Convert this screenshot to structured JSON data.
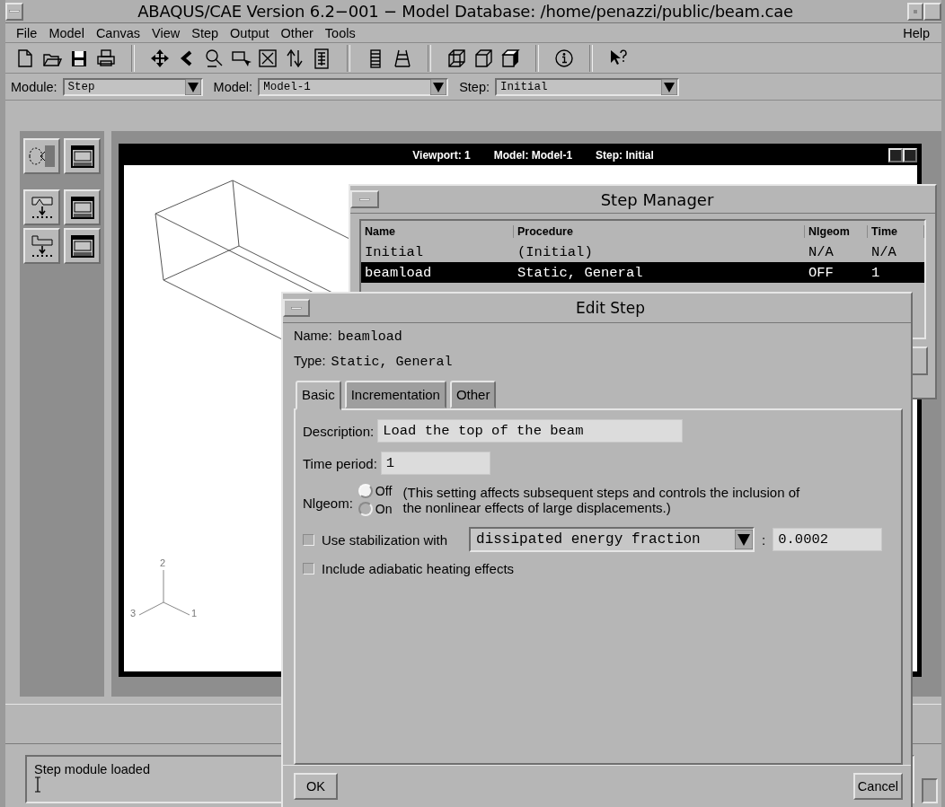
{
  "window": {
    "title": "ABAQUS/CAE Version 6.2−001 − Model Database: /home/penazzi/public/beam.cae"
  },
  "menu": {
    "items": [
      "File",
      "Model",
      "Canvas",
      "View",
      "Step",
      "Output",
      "Other",
      "Tools"
    ],
    "right_items": [
      "Help"
    ]
  },
  "context_bar": [
    {
      "label": "Module:",
      "value": "Step"
    },
    {
      "label": "Model:",
      "value": "Model-1"
    },
    {
      "label": "Step:",
      "value": "Initial"
    }
  ],
  "viewport": {
    "title_items": [
      "Viewport: 1",
      "Model: Model-1",
      "Step: Initial"
    ],
    "triad_labels": [
      "1",
      "2",
      "3"
    ]
  },
  "step_manager": {
    "title": "Step Manager",
    "columns": [
      "Name",
      "Procedure",
      "Nlgeom",
      "Time"
    ],
    "rows": [
      {
        "cells": [
          "Initial",
          "(Initial)",
          "N/A",
          "N/A"
        ],
        "selected": false
      },
      {
        "cells": [
          "beamload",
          "Static, General",
          "OFF",
          "1"
        ],
        "selected": true
      }
    ]
  },
  "edit_step": {
    "title": "Edit Step",
    "name_label": "Name:",
    "name": "beamload",
    "type_label": "Type:",
    "type": "Static, General",
    "tabs": [
      {
        "label": "Basic",
        "selected": true
      },
      {
        "label": "Incrementation",
        "selected": false
      },
      {
        "label": "Other",
        "selected": false
      }
    ],
    "description": {
      "label": "Description:",
      "value": "Load the top of the beam"
    },
    "time_period": {
      "label": "Time period:",
      "value": "1"
    },
    "nlgeom": {
      "label": "Nlgeom:",
      "options": [
        {
          "label": "Off",
          "selected": true
        },
        {
          "label": "On",
          "selected": false
        }
      ],
      "note": "(This setting affects subsequent steps and controls the inclusion of the nonlinear effects of large displacements.)"
    },
    "stabilization": {
      "label": "Use stabilization with",
      "checked": false,
      "method": "dissipated energy fraction",
      "separator": ":",
      "value": "0.0002"
    },
    "adiabatic": {
      "label": "Include adiabatic heating effects",
      "checked": false
    },
    "buttons": [
      "OK",
      "Cancel"
    ]
  },
  "message_area": {
    "text": "Step module loaded"
  }
}
